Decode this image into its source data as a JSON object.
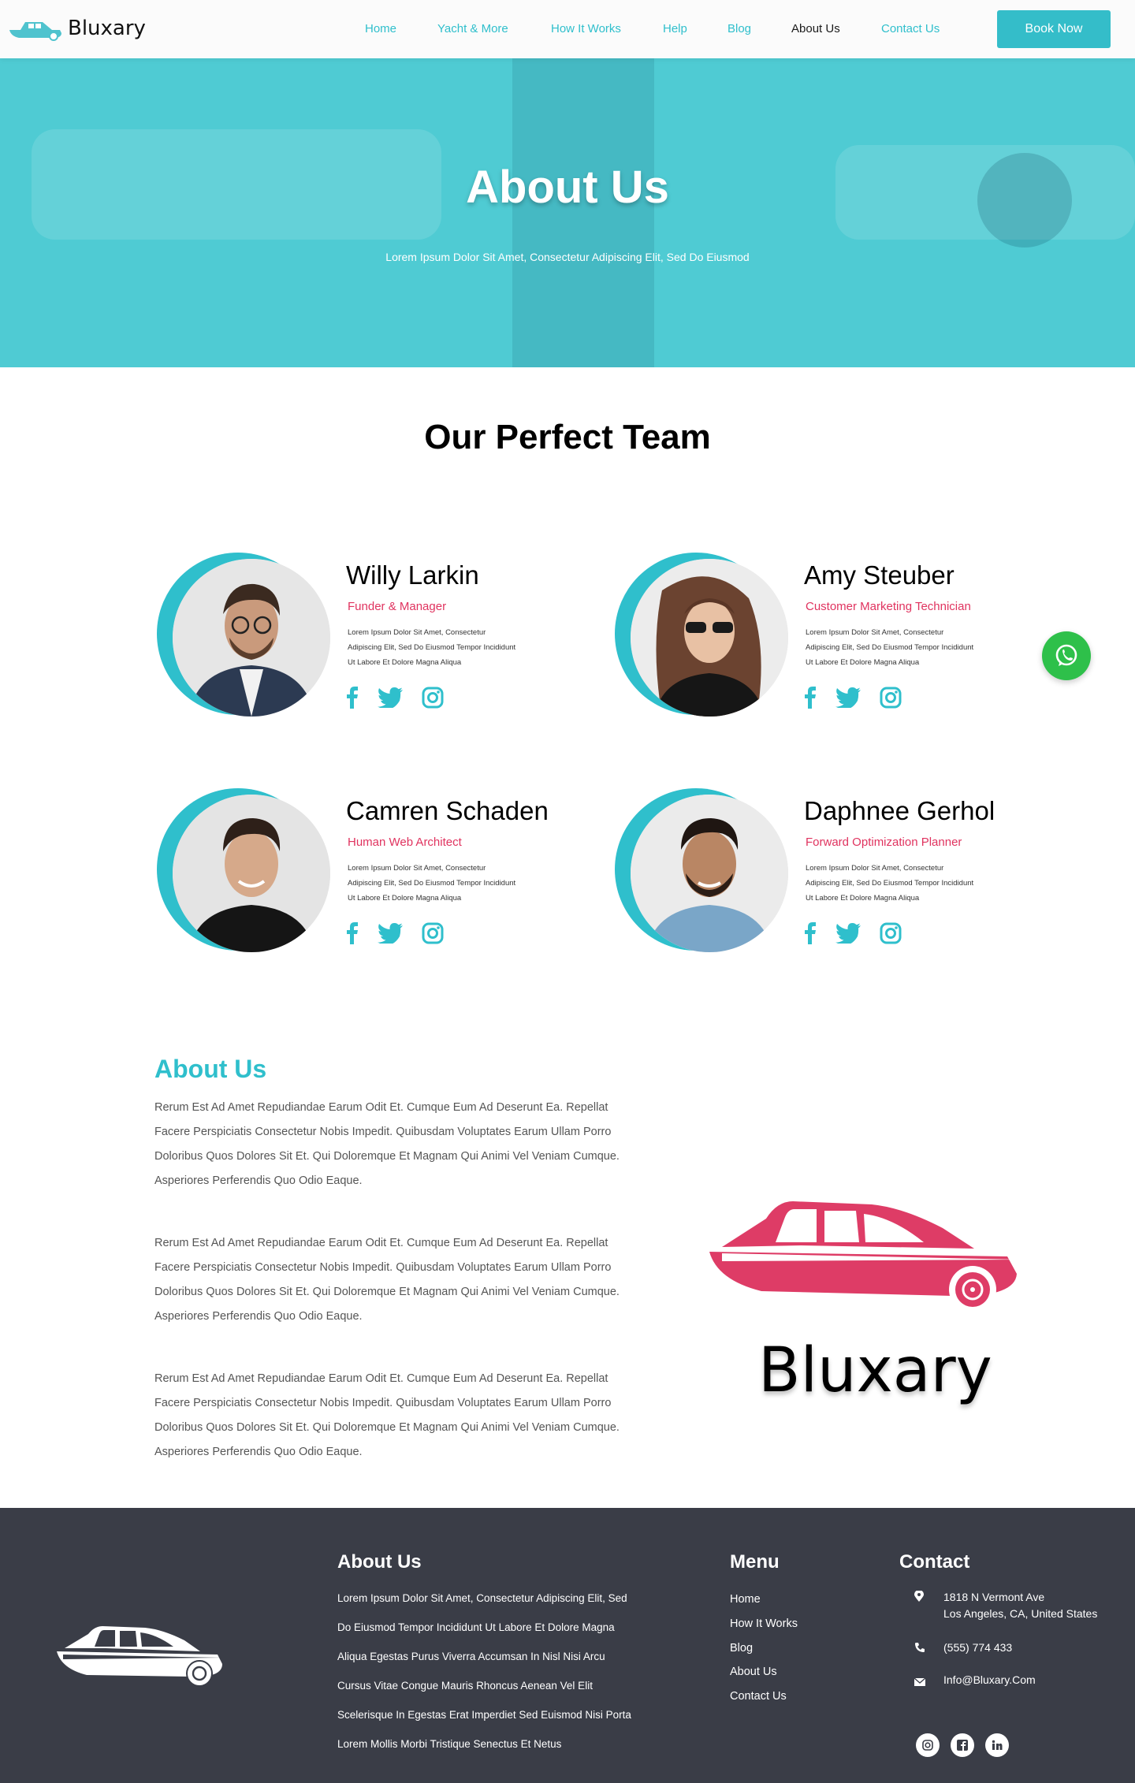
{
  "brand": {
    "name": "Bluxary"
  },
  "nav": {
    "links": [
      "Home",
      "Yacht & More",
      "How It Works",
      "Help",
      "Blog",
      "About Us",
      "Contact Us"
    ],
    "active": "About Us",
    "cta": "Book Now"
  },
  "hero": {
    "title": "About Us",
    "subtitle": "Lorem Ipsum Dolor Sit Amet, Consectetur Adipiscing Elit, Sed Do Eiusmod"
  },
  "team": {
    "title": "Our Perfect Team",
    "members": [
      {
        "name": "Willy Larkin",
        "role": "Funder & Manager",
        "desc": "Lorem Ipsum Dolor Sit Amet, Consectetur Adipiscing Elit, Sed Do Eiusmod Tempor Incididunt Ut Labore Et Dolore Magna Aliqua"
      },
      {
        "name": "Amy Steuber",
        "role": "Customer Marketing Technician",
        "desc": "Lorem Ipsum Dolor Sit Amet, Consectetur Adipiscing Elit, Sed Do Eiusmod Tempor Incididunt Ut Labore Et Dolore Magna Aliqua"
      },
      {
        "name": "Camren Schaden",
        "role": "Human Web Architect",
        "desc": "Lorem Ipsum Dolor Sit Amet, Consectetur Adipiscing Elit, Sed Do Eiusmod Tempor Incididunt Ut Labore Et Dolore Magna Aliqua"
      },
      {
        "name": "Daphnee Gerhol",
        "role": "Forward Optimization Planner",
        "desc": "Lorem Ipsum Dolor Sit Amet, Consectetur Adipiscing Elit, Sed Do Eiusmod Tempor Incididunt Ut Labore Et Dolore Magna Aliqua"
      }
    ],
    "social_icons": [
      "facebook-icon",
      "twitter-icon",
      "instagram-icon"
    ]
  },
  "about": {
    "title": "About Us",
    "paragraphs": [
      "Rerum Est Ad Amet Repudiandae Earum Odit Et. Cumque Eum Ad Deserunt Ea. Repellat Facere Perspiciatis Consectetur Nobis Impedit. Quibusdam Voluptates Earum Ullam Porro Doloribus Quos Dolores Sit Et. Qui Doloremque Et Magnam Qui Animi Vel Veniam Cumque. Asperiores Perferendis Quo Odio Eaque.",
      "Rerum Est Ad Amet Repudiandae Earum Odit Et. Cumque Eum Ad Deserunt Ea. Repellat Facere Perspiciatis Consectetur Nobis Impedit. Quibusdam Voluptates Earum Ullam Porro Doloribus Quos Dolores Sit Et. Qui Doloremque Et Magnam Qui Animi Vel Veniam Cumque. Asperiores Perferendis Quo Odio Eaque.",
      "Rerum Est Ad Amet Repudiandae Earum Odit Et. Cumque Eum Ad Deserunt Ea. Repellat Facere Perspiciatis Consectetur Nobis Impedit. Quibusdam Voluptates Earum Ullam Porro Doloribus Quos Dolores Sit Et. Qui Doloremque Et Magnam Qui Animi Vel Veniam Cumque. Asperiores Perferendis Quo Odio Eaque."
    ],
    "brand_text": "Bluxary"
  },
  "footer": {
    "about_title": "About Us",
    "about_lines": [
      "Lorem Ipsum Dolor Sit Amet, Consectetur Adipiscing Elit, Sed",
      "Do Eiusmod Tempor Incididunt Ut Labore Et Dolore Magna",
      "Aliqua Egestas Purus Viverra Accumsan In Nisl Nisi Arcu",
      "Cursus Vitae Congue Mauris Rhoncus Aenean Vel Elit",
      "Scelerisque In Egestas Erat Imperdiet Sed Euismod Nisi Porta",
      "Lorem Mollis Morbi Tristique Senectus Et Netus"
    ],
    "menu_title": "Menu",
    "menu_items": [
      "Home",
      "How It Works",
      "Blog",
      "About Us",
      "Contact Us"
    ],
    "contact_title": "Contact",
    "address_line1": "1818 N Vermont Ave",
    "address_line2": "Los Angeles, CA, United States",
    "phone": "(555) 774 433",
    "email": "Info@Bluxary.Com",
    "social": [
      "instagram-icon",
      "facebook-icon",
      "linkedin-icon"
    ]
  },
  "colors": {
    "accent": "#2fbfcc",
    "pink": "#e0335f",
    "footer": "#3a3d47",
    "whatsapp": "#2ec04a"
  }
}
